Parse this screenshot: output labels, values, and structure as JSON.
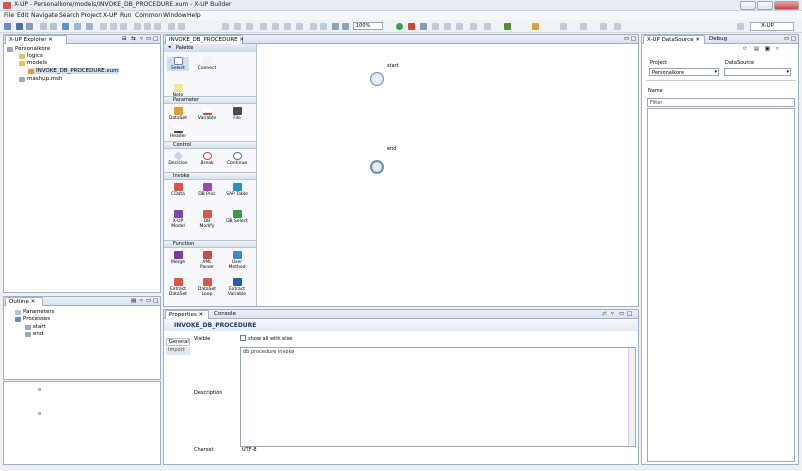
{
  "window": {
    "title": "X-UP - Personalkore/models/INVOKE_DB_PROCEDURE.xum - X-UP Builder"
  },
  "menu": [
    "File",
    "Edit",
    "Navigate",
    "Search",
    "Project",
    "X-UP",
    "Run",
    "Common",
    "Window",
    "Help"
  ],
  "toolbar": {
    "zoom": "100%",
    "perspective": "X-UP"
  },
  "explorer": {
    "tab": "X-UP Explorer",
    "items": [
      "Personalkore",
      "logics",
      "models",
      "INVOKE_DB_PROCEDURE.xum",
      "mashup.msh"
    ]
  },
  "outline": {
    "tab": "Outline",
    "items": [
      "Parameters",
      "Processes",
      "start",
      "end"
    ]
  },
  "editor": {
    "tab": "INVOKE_DB_PROCEDURE",
    "nodes": {
      "start": "start",
      "end": "end"
    }
  },
  "palette": {
    "title": "Palette",
    "tools": [
      "Select",
      "Connect",
      "Note"
    ],
    "sections": [
      {
        "name": "Parameter",
        "items": [
          "DataSet",
          "Variable",
          "File",
          "Header"
        ]
      },
      {
        "name": "Control",
        "items": [
          "Decision",
          "Break",
          "Continue"
        ]
      },
      {
        "name": "Invoke",
        "items": [
          "CData",
          "DB Proc",
          "SAP Table",
          "X-UP Model",
          "DB Modify",
          "DB Select"
        ]
      },
      {
        "name": "Function",
        "items": [
          "Merge",
          "XML Parser",
          "User Method",
          "Extract DataSet",
          "DataSet Loop",
          "Extract Variable"
        ]
      }
    ]
  },
  "properties": {
    "tabs": [
      "Properties",
      "Console"
    ],
    "title": "INVOKE_DB_PROCEDURE",
    "sidetabs": [
      "General",
      "Import"
    ],
    "visible_label": "Visible",
    "show_all": "show all with else",
    "description_label": "Description",
    "description_value": "db procedure invoke",
    "charset_label": "Charset",
    "charset_value": "UTF-8"
  },
  "datasource": {
    "tabs": [
      "X-UP DataSource",
      "Debug"
    ],
    "project_label": "Project",
    "project_value": "Personalkore",
    "datasource_label": "DataSource",
    "name_label": "Name",
    "filter_label": "Filter"
  }
}
